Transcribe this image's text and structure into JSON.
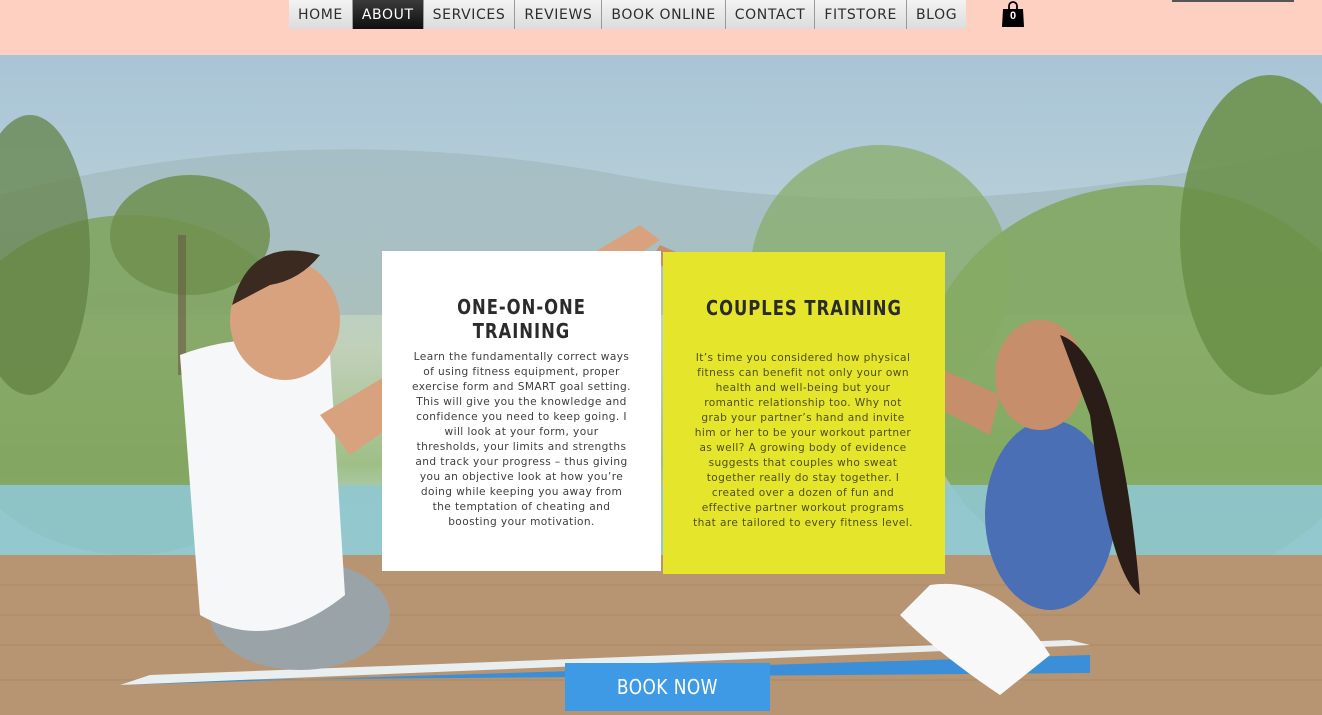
{
  "nav": {
    "items": [
      {
        "label": "HOME",
        "active": false
      },
      {
        "label": "ABOUT",
        "active": true
      },
      {
        "label": "SERVICES",
        "active": false
      },
      {
        "label": "REVIEWS",
        "active": false
      },
      {
        "label": "BOOK ONLINE",
        "active": false
      },
      {
        "label": "CONTACT",
        "active": false
      },
      {
        "label": "FITSTORE",
        "active": false
      },
      {
        "label": "BLOG",
        "active": false
      }
    ],
    "cart_count": "0"
  },
  "cards": {
    "one_on_one": {
      "title": "ONE-ON-ONE TRAINING",
      "text": "Learn the fundamentally correct ways of using fitness equipment, proper exercise form and SMART goal setting. This will give you the knowledge and confidence you need to keep going. I will look at your form, your thresholds, your limits and strengths and track your progress – thus giving you an objective look at how you’re doing while keeping you away from the temptation of cheating and boosting your motivation."
    },
    "couples": {
      "title": "COUPLES TRAINING",
      "text": "It’s time you considered how physical fitness can benefit not only your own health and well-being but your romantic relationship too. Why not grab your partner’s hand and invite him or her to be your workout partner as well? A growing body of evidence suggests that couples who sweat together really do stay together. I created over a dozen of fun and effective partner workout programs that are tailored to every fitness level."
    }
  },
  "cta": {
    "book_now": "BOOK NOW"
  },
  "colors": {
    "header_bg": "#fdd0c2",
    "accent_yellow": "#e5e62c",
    "button_blue": "#3e9ae4",
    "nav_active": "#1a1a1a"
  },
  "icons": {
    "cart": "shopping-bag-icon"
  }
}
